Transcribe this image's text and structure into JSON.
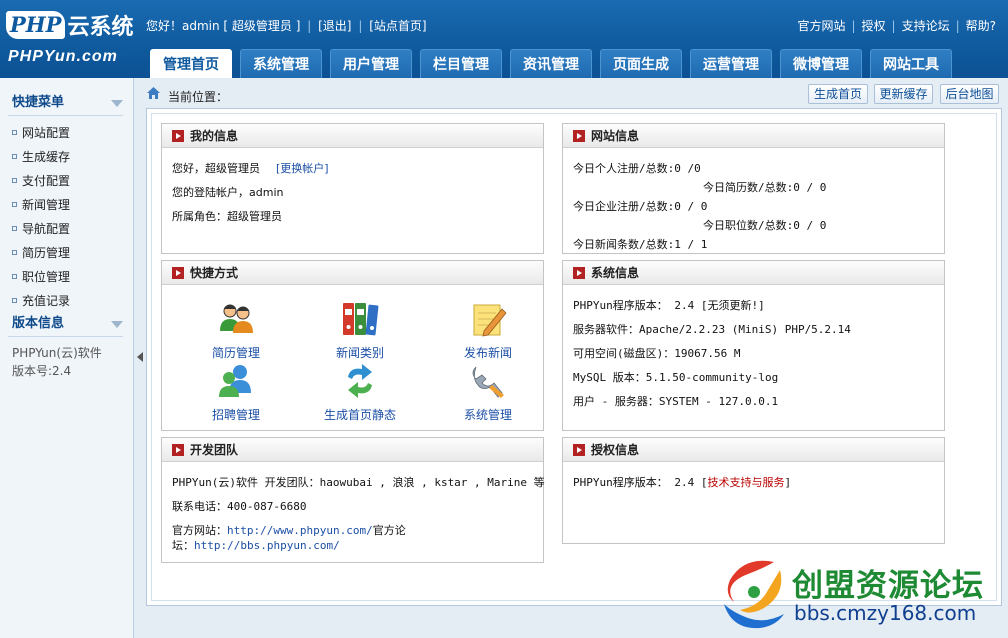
{
  "logo": {
    "php": "PHP",
    "yun": "云系统",
    "domain": "PHPYun.com"
  },
  "welcome": {
    "greeting": "您好！admin [ 超级管理员 ]",
    "logout": "[退出]",
    "site_home": "[站点首页]"
  },
  "toplinks": [
    "官方网站",
    "授权",
    "支持论坛",
    "帮助?"
  ],
  "tabs": [
    "管理首页",
    "系统管理",
    "用户管理",
    "栏目管理",
    "资讯管理",
    "页面生成",
    "运营管理",
    "微博管理",
    "网站工具"
  ],
  "active_tab": 0,
  "sidebar": {
    "quick_title": "快捷菜单",
    "items": [
      "网站配置",
      "生成缓存",
      "支付配置",
      "新闻管理",
      "导航配置",
      "简历管理",
      "职位管理",
      "充值记录"
    ],
    "version_title": "版本信息",
    "version_line1": "PHPYun(云)软件",
    "version_line2": "版本号:2.4"
  },
  "breadcrumb": {
    "label": "当前位置：",
    "buttons": [
      "生成首页",
      "更新缓存",
      "后台地图"
    ]
  },
  "my_info": {
    "title": "我的信息",
    "greeting": "您好，超级管理员",
    "switch": "[更换帐户]",
    "account": "您的登陆帐户，admin",
    "role": "所属角色：超级管理员"
  },
  "site_info": {
    "title": "网站信息",
    "lines": [
      "今日个人注册/总数:0 /0",
      "今日简历数/总数:0 / 0",
      "今日企业注册/总数:0 / 0",
      "今日职位数/总数:0 / 0",
      "今日新闻条数/总数:1 / 1"
    ]
  },
  "shortcuts": {
    "title": "快捷方式",
    "items": [
      {
        "label": "简历管理",
        "icon": "people-icon"
      },
      {
        "label": "新闻类别",
        "icon": "binders-icon"
      },
      {
        "label": "发布新闻",
        "icon": "notepad-pencil-icon"
      },
      {
        "label": "招聘管理",
        "icon": "users-icon"
      },
      {
        "label": "生成首页静态",
        "icon": "refresh-arrows-icon"
      },
      {
        "label": "系统管理",
        "icon": "wrench-icon"
      }
    ]
  },
  "system_info": {
    "title": "系统信息",
    "lines": [
      "PHPYun程序版本： 2.4 [无须更新!]",
      "服务器软件：Apache/2.2.23 (MiniS) PHP/5.2.14",
      "可用空间(磁盘区)：19067.56 M",
      "MySQL 版本：5.1.50-community-log",
      "用户 - 服务器：SYSTEM - 127.0.0.1"
    ]
  },
  "dev_team": {
    "title": "开发团队",
    "team": "PHPYun(云)软件 开发团队：haowubai , 浪浪 , kstar , Marine 等",
    "phone": "联系电话：400-087-6680",
    "site_prefix": "官方网站：",
    "site_url": "http://www.phpyun.com/",
    "forum_prefix": "官方论",
    "forum_prefix2": "坛：",
    "forum_url": "http://bbs.phpyun.com/"
  },
  "license_info": {
    "title": "授权信息",
    "version": "PHPYun程序版本： 2.4 [",
    "support": "技术支持与服务",
    "close": "]"
  },
  "watermark": {
    "name": "创盟资源论坛",
    "url": "bbs.cmzy168.com"
  },
  "colors": {
    "header": "#0f5a9e",
    "tab": "#1f6bb1",
    "link": "#1c4fa6",
    "title_marker": "#b22222"
  }
}
